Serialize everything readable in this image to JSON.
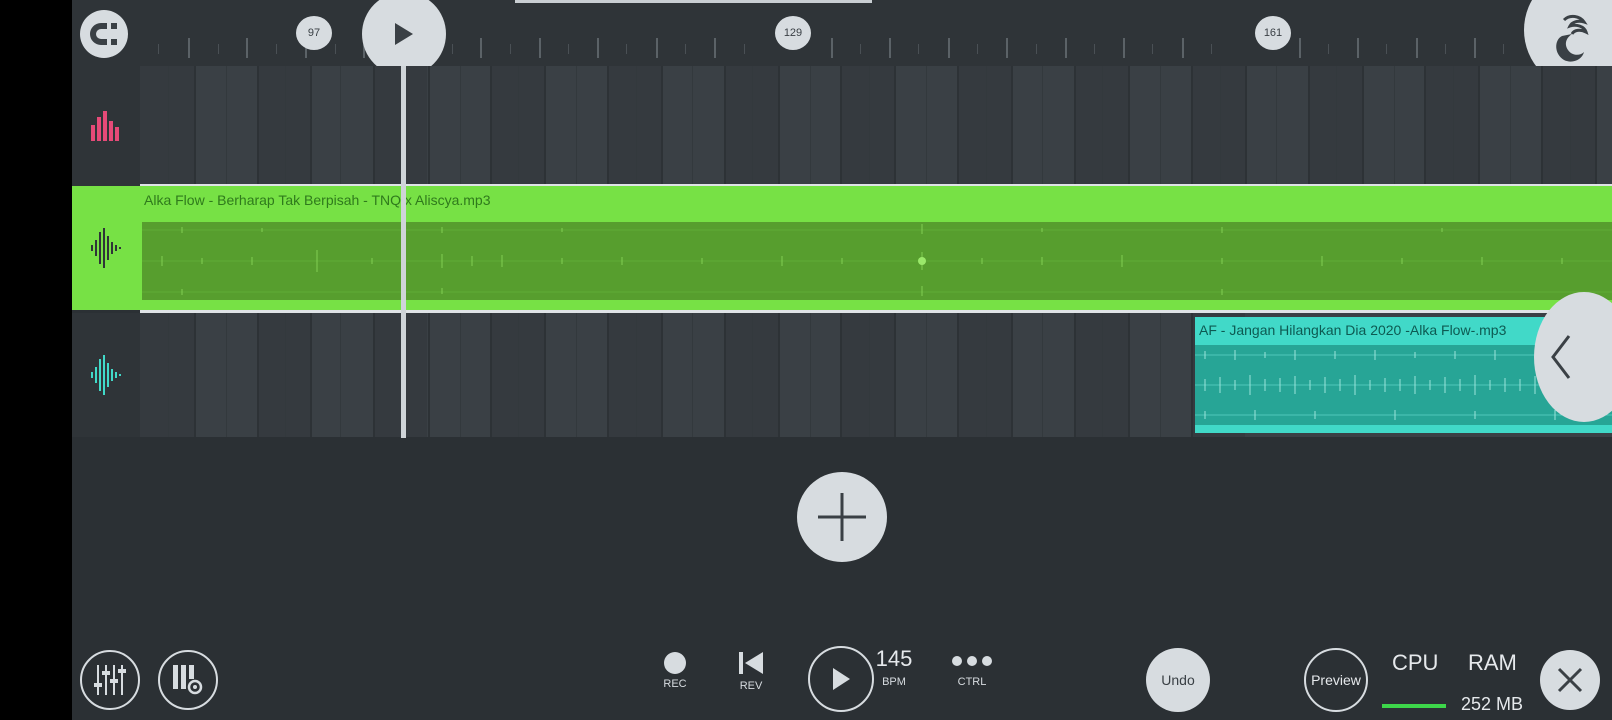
{
  "ruler": {
    "markers": [
      "97",
      "129",
      "161"
    ]
  },
  "tracks": {
    "clip1_label": "Alka Flow - Berharap Tak Berpisah - TNQ x Aliscya.mp3",
    "clip2_label": "AF - Jangan Hilangkan Dia 2020 -Alka Flow-.mp3"
  },
  "transport": {
    "rec": "REC",
    "rev": "REV",
    "bpm_value": "145",
    "bpm": "BPM",
    "ctrl": "CTRL",
    "undo": "Undo",
    "preview": "Preview"
  },
  "meters": {
    "cpu": "CPU",
    "ram": "RAM",
    "ram_value": "252 MB"
  },
  "colors": {
    "audio_clip_1": "#77e145",
    "audio_clip_2": "#41d9c8",
    "mixer_icon": "#e64a78",
    "cpu_bar": "#3dd64a"
  },
  "icons": [
    "snap-magnet-icon",
    "play-icon",
    "fl-fruit-logo-icon",
    "mixer-bars-icon",
    "audio-wave-icon",
    "chevron-left-icon",
    "plus-icon",
    "mixer-sliders-icon",
    "piano-settings-icon",
    "record-icon",
    "rewind-icon",
    "close-icon",
    "more-dots-icon"
  ]
}
